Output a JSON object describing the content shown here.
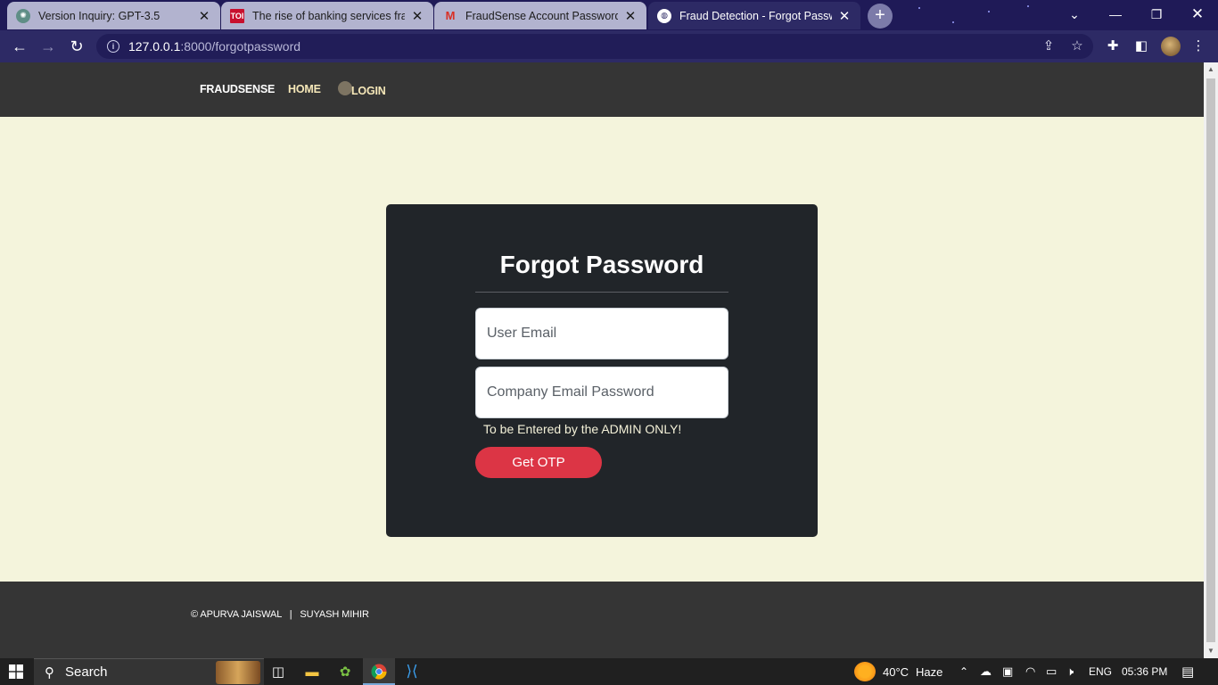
{
  "browser": {
    "tabs": [
      {
        "title": "Version Inquiry: GPT-3.5",
        "favicon": "openai-icon",
        "active": false
      },
      {
        "title": "The rise of banking services fraud",
        "favicon": "toi-icon",
        "active": false
      },
      {
        "title": "FraudSense Account Password Ch",
        "favicon": "gmail-icon",
        "active": false
      },
      {
        "title": "Fraud Detection - Forgot Password",
        "favicon": "globe-icon",
        "active": true
      }
    ],
    "url_host": "127.0.0.1",
    "url_path": ":8000/forgotpassword",
    "favicon_labels": {
      "toi": "TOI",
      "gmail": "M"
    }
  },
  "site": {
    "brand": "FRAUDSENSE",
    "nav_home": "HOME",
    "nav_login": "LOGIN",
    "form": {
      "title": "Forgot Password",
      "email_placeholder": "User Email",
      "company_password_placeholder": "Company Email Password",
      "hint": "To be Entered by the ADMIN ONLY!",
      "submit_label": "Get OTP"
    },
    "footer": "© APURVA JAISWAL   |   SUYASH MIHIR"
  },
  "taskbar": {
    "search_label": "Search",
    "weather_temp": "40°C",
    "weather_desc": "Haze",
    "language": "ENG",
    "time": "05:36 PM"
  },
  "colors": {
    "page_bg": "#f4f4dc",
    "nav_bg": "#353535",
    "card_bg": "#212529",
    "button_red": "#dc3545",
    "nav_link": "#f5e7b8"
  }
}
